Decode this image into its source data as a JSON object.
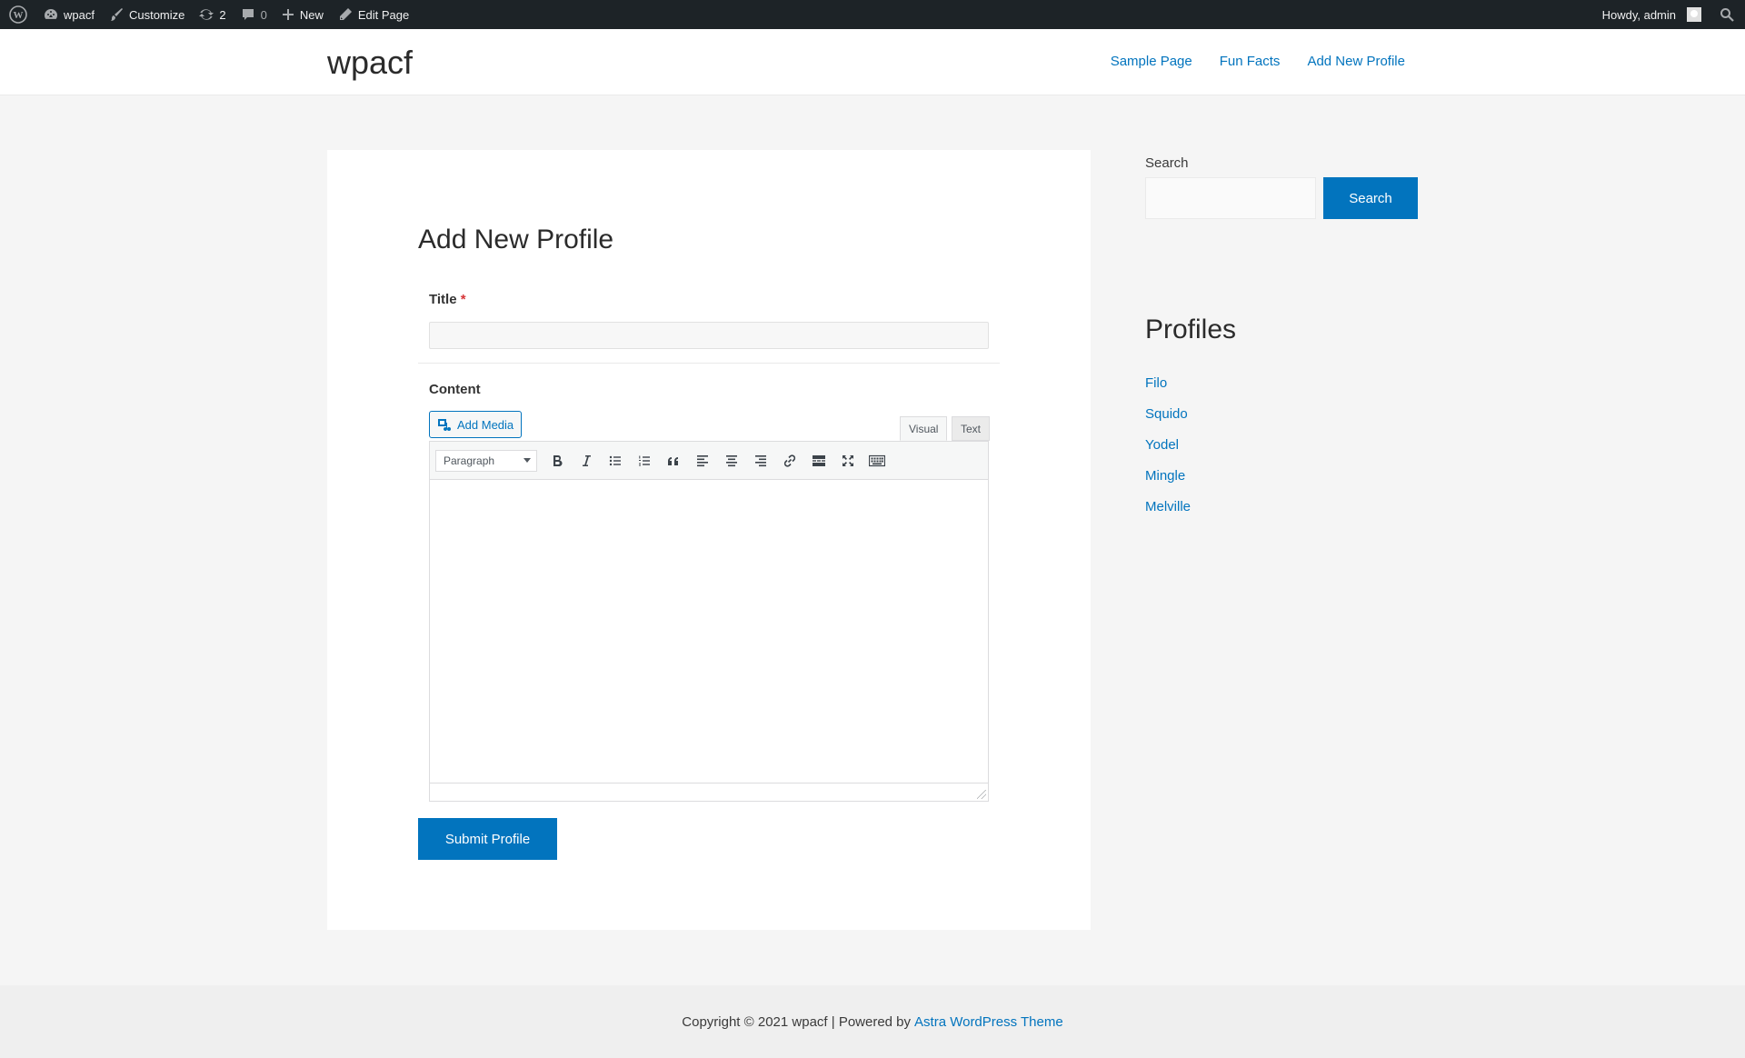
{
  "adminbar": {
    "site_name": "wpacf",
    "customize": "Customize",
    "updates_count": "2",
    "comments_count": "0",
    "new": "New",
    "edit_page": "Edit Page",
    "howdy": "Howdy, admin"
  },
  "header": {
    "site_title": "wpacf",
    "nav": [
      "Sample Page",
      "Fun Facts",
      "Add New Profile"
    ]
  },
  "form": {
    "page_title": "Add New Profile",
    "title_label": "Title",
    "required_mark": "*",
    "title_value": "",
    "content_label": "Content",
    "add_media": "Add Media",
    "tab_visual": "Visual",
    "tab_text": "Text",
    "format_select": "Paragraph",
    "submit": "Submit Profile"
  },
  "sidebar": {
    "search_label": "Search",
    "search_button": "Search",
    "search_value": "",
    "profiles_title": "Profiles",
    "profiles": [
      "Filo",
      "Squido",
      "Yodel",
      "Mingle",
      "Melville"
    ]
  },
  "footer": {
    "copyright": "Copyright © 2021 wpacf | Powered by",
    "theme_link": "Astra WordPress Theme"
  },
  "colors": {
    "accent": "#0274be",
    "adminbar": "#1d2327",
    "background": "#f5f5f5"
  }
}
